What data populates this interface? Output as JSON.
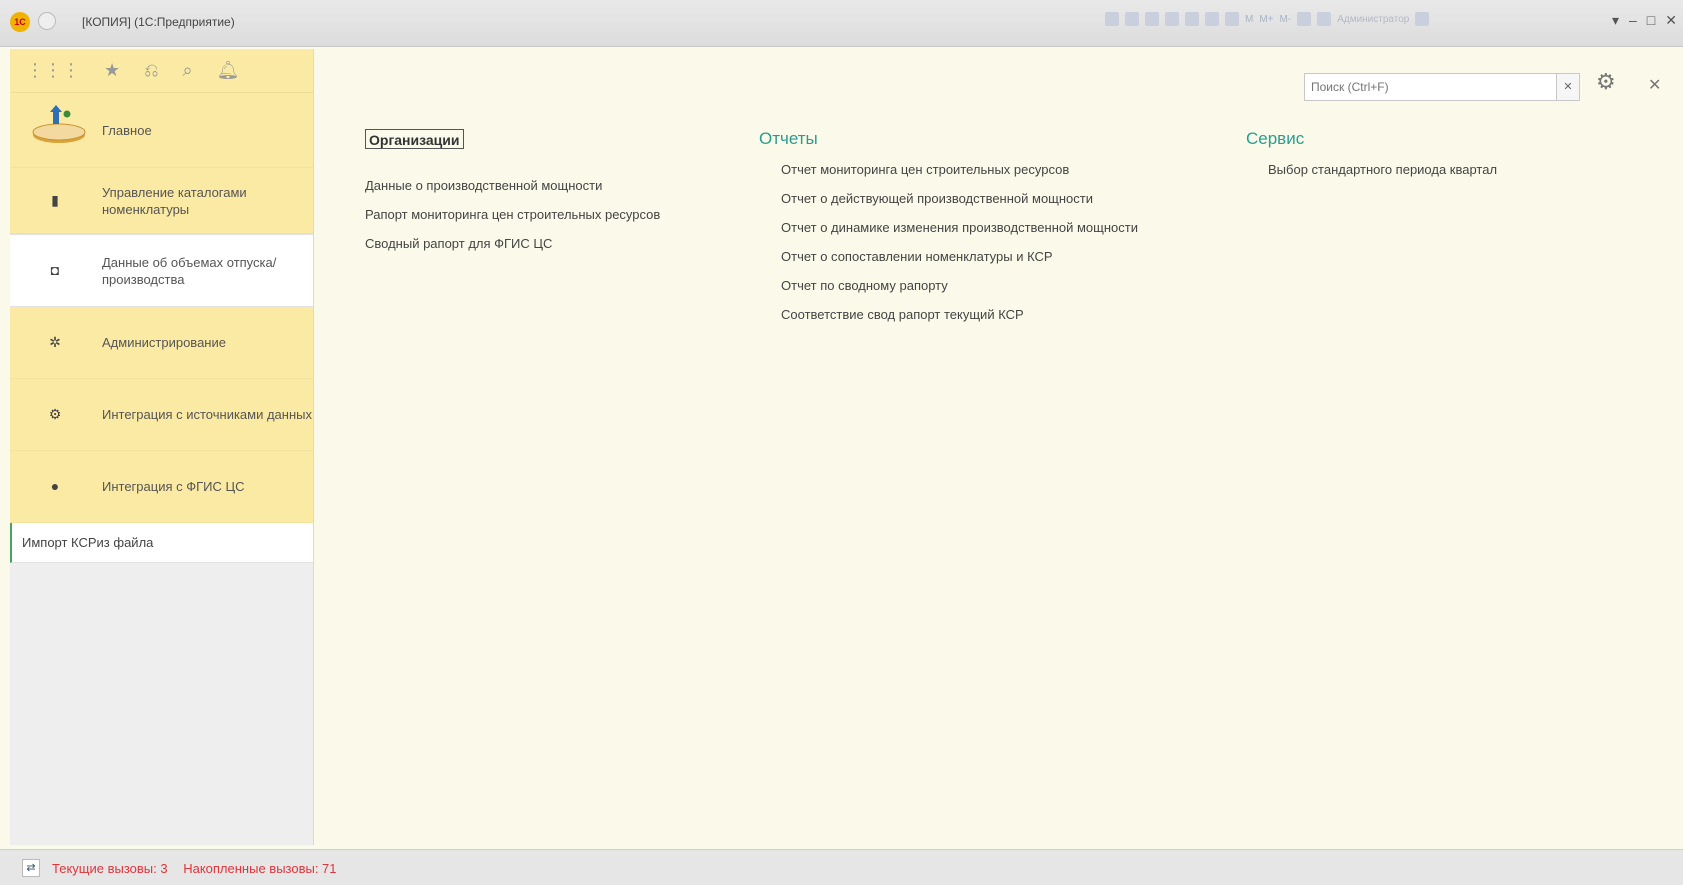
{
  "window": {
    "title": "[КОПИЯ] (1С:Предприятие)",
    "tools_text": [
      "M",
      "M+",
      "M-"
    ],
    "user": "Администратор"
  },
  "sidebar": {
    "sections": [
      {
        "label": "Главное",
        "icon": "home-illustration-icon"
      },
      {
        "label": "Управление каталогами номенклатуры",
        "icon": "catalog-icon"
      },
      {
        "label": "Данные об объемах отпуска/производства",
        "icon": "production-icon"
      },
      {
        "label": "Администрирование",
        "icon": "gear-icon"
      },
      {
        "label": "Интеграция с источниками данных",
        "icon": "integration-icon"
      },
      {
        "label": "Интеграция с ФГИС ЦС",
        "icon": "fgis-icon"
      }
    ],
    "sub_item": "Импорт КСРиз файла"
  },
  "search": {
    "placeholder": "Поиск (Ctrl+F)"
  },
  "columns": {
    "organizations": {
      "title": "Организации",
      "links": [
        "Данные о производственной мощности",
        "Рапорт мониторинга цен строительных ресурсов",
        "Сводный рапорт для ФГИС ЦС"
      ]
    },
    "reports": {
      "title": "Отчеты",
      "links": [
        "Отчет мониторинга цен строительных ресурсов",
        "Отчет о действующей производственной мощности",
        "Отчет о динамике изменения производственной мощности",
        "Отчет о сопоставлении номенклатуры и КСР",
        "Отчет по сводному рапорту",
        "Соответствие свод рапорт текущий КСР"
      ]
    },
    "service": {
      "title": "Сервис",
      "links": [
        "Выбор стандартного периода квартал"
      ]
    }
  },
  "status": {
    "current_calls": "Текущие вызовы: 3",
    "accumulated_calls": "Накопленные вызовы: 71"
  },
  "colors": {
    "accent": "#2a9d8f",
    "sidebar_yellow": "#fbeaa3",
    "content_bg": "#fbfaea",
    "status_red": "#e0353a"
  }
}
